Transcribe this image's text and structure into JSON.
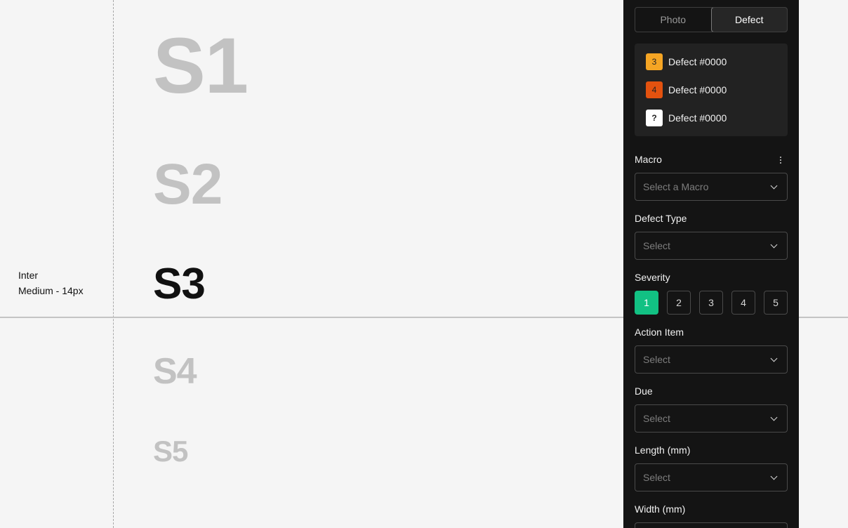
{
  "typography_note": {
    "line1": "Inter",
    "line2": "Medium - 14px"
  },
  "severity_labels": [
    "S1",
    "S2",
    "S3",
    "S4",
    "S5"
  ],
  "panel": {
    "tabs": [
      {
        "label": "Photo",
        "active": false
      },
      {
        "label": "Defect",
        "active": true
      }
    ],
    "defects": [
      {
        "badge": "3",
        "badge_color": "#f5a524",
        "label": "Defect #0000"
      },
      {
        "badge": "4",
        "badge_color": "#e3520f",
        "label": "Defect #0000"
      },
      {
        "badge": "?",
        "badge_color": "#ffffff",
        "label": "Defect #0000"
      }
    ],
    "macro": {
      "label": "Macro",
      "placeholder": "Select a Macro",
      "icon": "more-vertical-icon"
    },
    "defect_type": {
      "label": "Defect Type",
      "placeholder": "Select"
    },
    "severity": {
      "label": "Severity",
      "options": [
        "1",
        "2",
        "3",
        "4",
        "5"
      ],
      "selected": "1",
      "selected_color": "#12c183"
    },
    "action_item": {
      "label": "Action Item",
      "placeholder": "Select"
    },
    "due": {
      "label": "Due",
      "placeholder": "Select"
    },
    "length": {
      "label": "Length (mm)",
      "placeholder": "Select"
    },
    "width": {
      "label": "Width (mm)"
    }
  }
}
